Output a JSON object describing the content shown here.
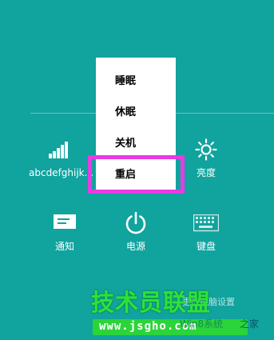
{
  "power_menu": {
    "items": [
      {
        "label": "睡眠"
      },
      {
        "label": "休眠"
      },
      {
        "label": "关机"
      },
      {
        "label": "重启"
      }
    ],
    "highlighted_item": "重启",
    "highlight_color": "#e93ae4"
  },
  "tiles": {
    "network": {
      "label": "abcdefghijk...",
      "icon": "wifi-signal-icon"
    },
    "brightness": {
      "label": "亮度",
      "icon": "brightness-icon"
    },
    "notifications": {
      "label": "通知",
      "icon": "notification-icon"
    },
    "power": {
      "label": "电源",
      "icon": "power-icon"
    },
    "keyboard": {
      "label": "键盘",
      "icon": "keyboard-icon"
    }
  },
  "watermark": {
    "title": "技术员联盟",
    "url": "www.jsgho.com",
    "win_text": "Win8系统",
    "side_text": "之家",
    "faint_text": "更改电脑设置"
  },
  "colors": {
    "background": "#11a39e",
    "menu_background": "#ffffff",
    "watermark_green": "#2bd43a"
  }
}
